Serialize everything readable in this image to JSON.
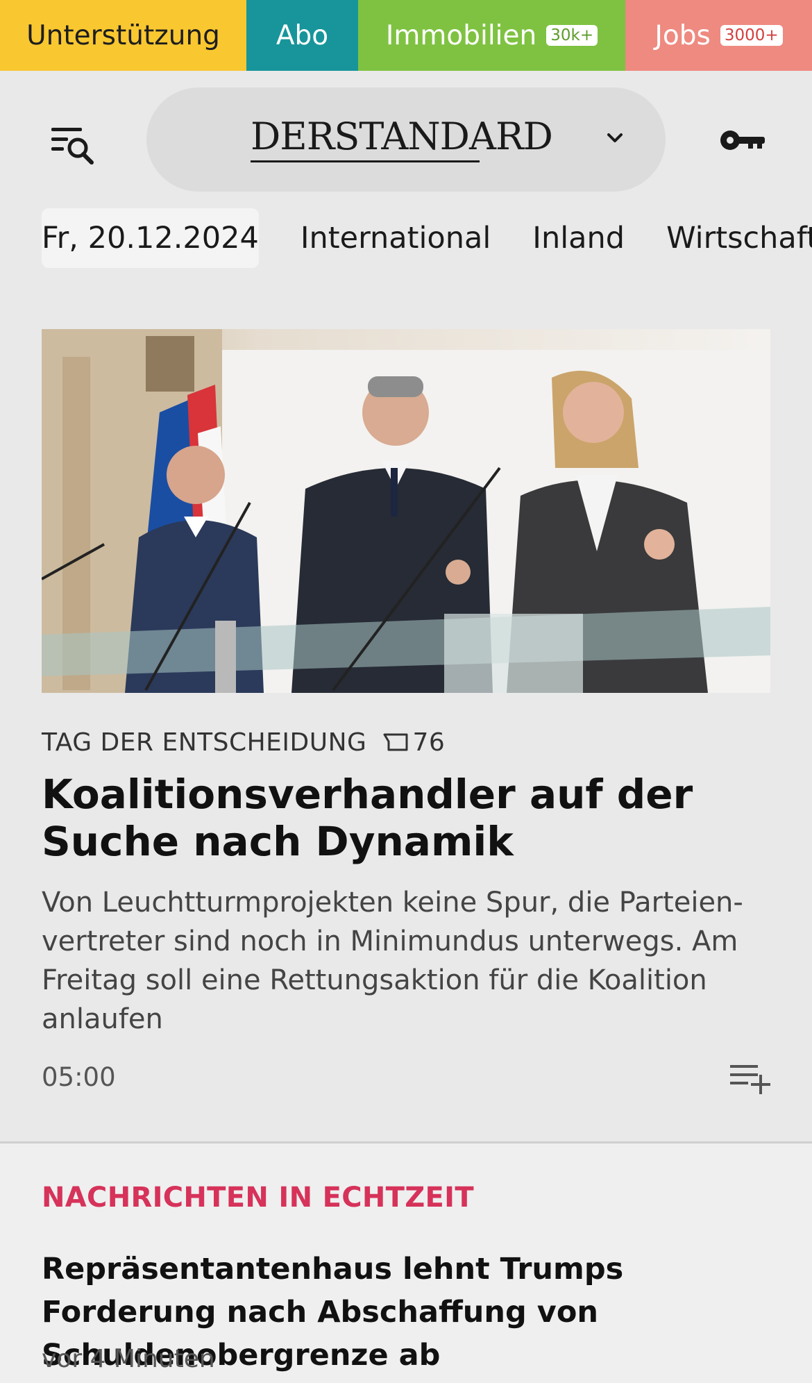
{
  "topbar": {
    "support_label": "Unterstützung",
    "abo_label": "Abo",
    "immo_label": "Immobilien",
    "immo_badge": "30k+",
    "jobs_label": "Jobs",
    "jobs_badge": "3000+",
    "colors": {
      "support": "#f9c730",
      "abo": "#17959b",
      "immo": "#7fc242",
      "jobs": "#ee8a80"
    }
  },
  "header": {
    "logo": "DERSTANDARD",
    "menu_icon": "menu-search-icon",
    "chevron_icon": "chevron-down-icon",
    "key_icon": "key-icon"
  },
  "nav": {
    "date": "Fr, 20.12.2024",
    "items": [
      "International",
      "Inland",
      "Wirtschaft"
    ]
  },
  "hero": {
    "kicker": "TAG DER ENTSCHEIDUNG",
    "comment_count": "76",
    "headline": "Koalitionsverhandler auf der Suche nach Dynamik",
    "teaser": "Von Leuchtturmprojekten keine Spur, die Parteien-vertreter sind noch in Minimundus unterwegs. Am Freitag soll eine Rettungsaktion für die Koalition anlaufen",
    "time": "05:00",
    "playlist_icon": "playlist-add-icon"
  },
  "live": {
    "label": "NACHRICHTEN IN ECHTZEIT",
    "headline": "Repräsentantenhaus lehnt Trumps Forderung nach Abschaffung von Schuldenobergrenze ab",
    "time": "vor 4 Minuten",
    "accent_color": "#d6325a"
  }
}
